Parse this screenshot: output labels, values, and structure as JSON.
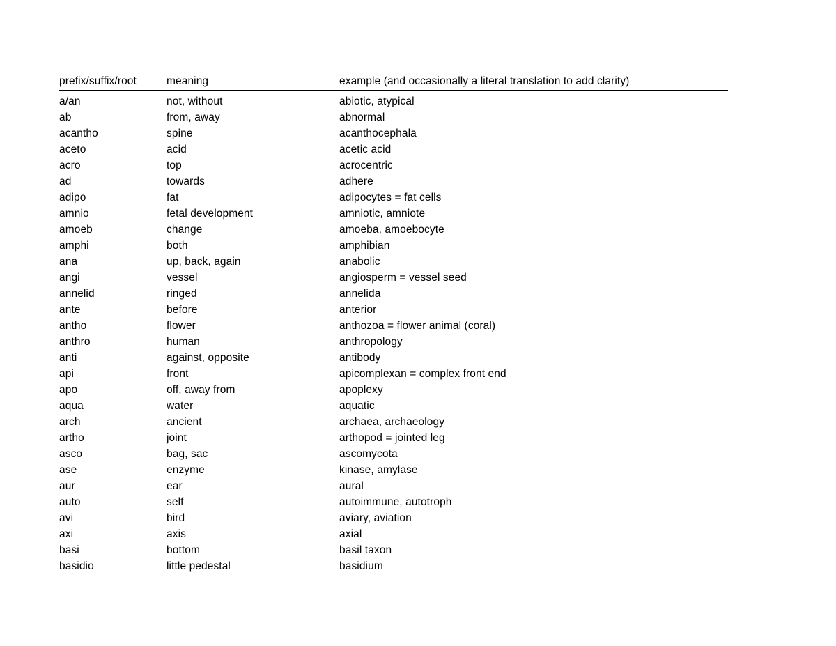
{
  "table": {
    "headers": {
      "term": "prefix/suffix/root",
      "meaning": "meaning",
      "example": "example (and occasionally a literal translation to add clarity)"
    },
    "rows": [
      {
        "term": "a/an",
        "meaning": "not, without",
        "example": "abiotic, atypical"
      },
      {
        "term": "ab",
        "meaning": "from, away",
        "example": "abnormal"
      },
      {
        "term": "acantho",
        "meaning": "spine",
        "example": "acanthocephala"
      },
      {
        "term": "aceto",
        "meaning": "acid",
        "example": "acetic acid"
      },
      {
        "term": "acro",
        "meaning": "top",
        "example": "acrocentric"
      },
      {
        "term": "ad",
        "meaning": "towards",
        "example": "adhere"
      },
      {
        "term": "adipo",
        "meaning": "fat",
        "example": "adipocytes = fat cells"
      },
      {
        "term": "amnio",
        "meaning": "fetal development",
        "example": "amniotic, amniote"
      },
      {
        "term": "amoeb",
        "meaning": "change",
        "example": "amoeba, amoebocyte"
      },
      {
        "term": "amphi",
        "meaning": "both",
        "example": "amphibian"
      },
      {
        "term": "ana",
        "meaning": "up, back, again",
        "example": "anabolic"
      },
      {
        "term": "angi",
        "meaning": "vessel",
        "example": "angiosperm = vessel seed"
      },
      {
        "term": "annelid",
        "meaning": "ringed",
        "example": "annelida"
      },
      {
        "term": "ante",
        "meaning": "before",
        "example": "anterior"
      },
      {
        "term": "antho",
        "meaning": "flower",
        "example": "anthozoa = flower animal (coral)"
      },
      {
        "term": "anthro",
        "meaning": "human",
        "example": "anthropology"
      },
      {
        "term": "anti",
        "meaning": "against, opposite",
        "example": "antibody"
      },
      {
        "term": "api",
        "meaning": "front",
        "example": "apicomplexan = complex front end"
      },
      {
        "term": "apo",
        "meaning": "off, away from",
        "example": "apoplexy"
      },
      {
        "term": "aqua",
        "meaning": "water",
        "example": "aquatic"
      },
      {
        "term": "arch",
        "meaning": "ancient",
        "example": "archaea, archaeology"
      },
      {
        "term": "artho",
        "meaning": "joint",
        "example": "arthopod = jointed leg"
      },
      {
        "term": "asco",
        "meaning": "bag, sac",
        "example": "ascomycota"
      },
      {
        "term": "ase",
        "meaning": "enzyme",
        "example": "kinase, amylase"
      },
      {
        "term": "aur",
        "meaning": "ear",
        "example": "aural"
      },
      {
        "term": "auto",
        "meaning": "self",
        "example": "autoimmune, autotroph"
      },
      {
        "term": "avi",
        "meaning": "bird",
        "example": "aviary, aviation"
      },
      {
        "term": "axi",
        "meaning": "axis",
        "example": "axial"
      },
      {
        "term": "basi",
        "meaning": "bottom",
        "example": "basil taxon"
      },
      {
        "term": "basidio",
        "meaning": "little pedestal",
        "example": "basidium"
      }
    ]
  }
}
